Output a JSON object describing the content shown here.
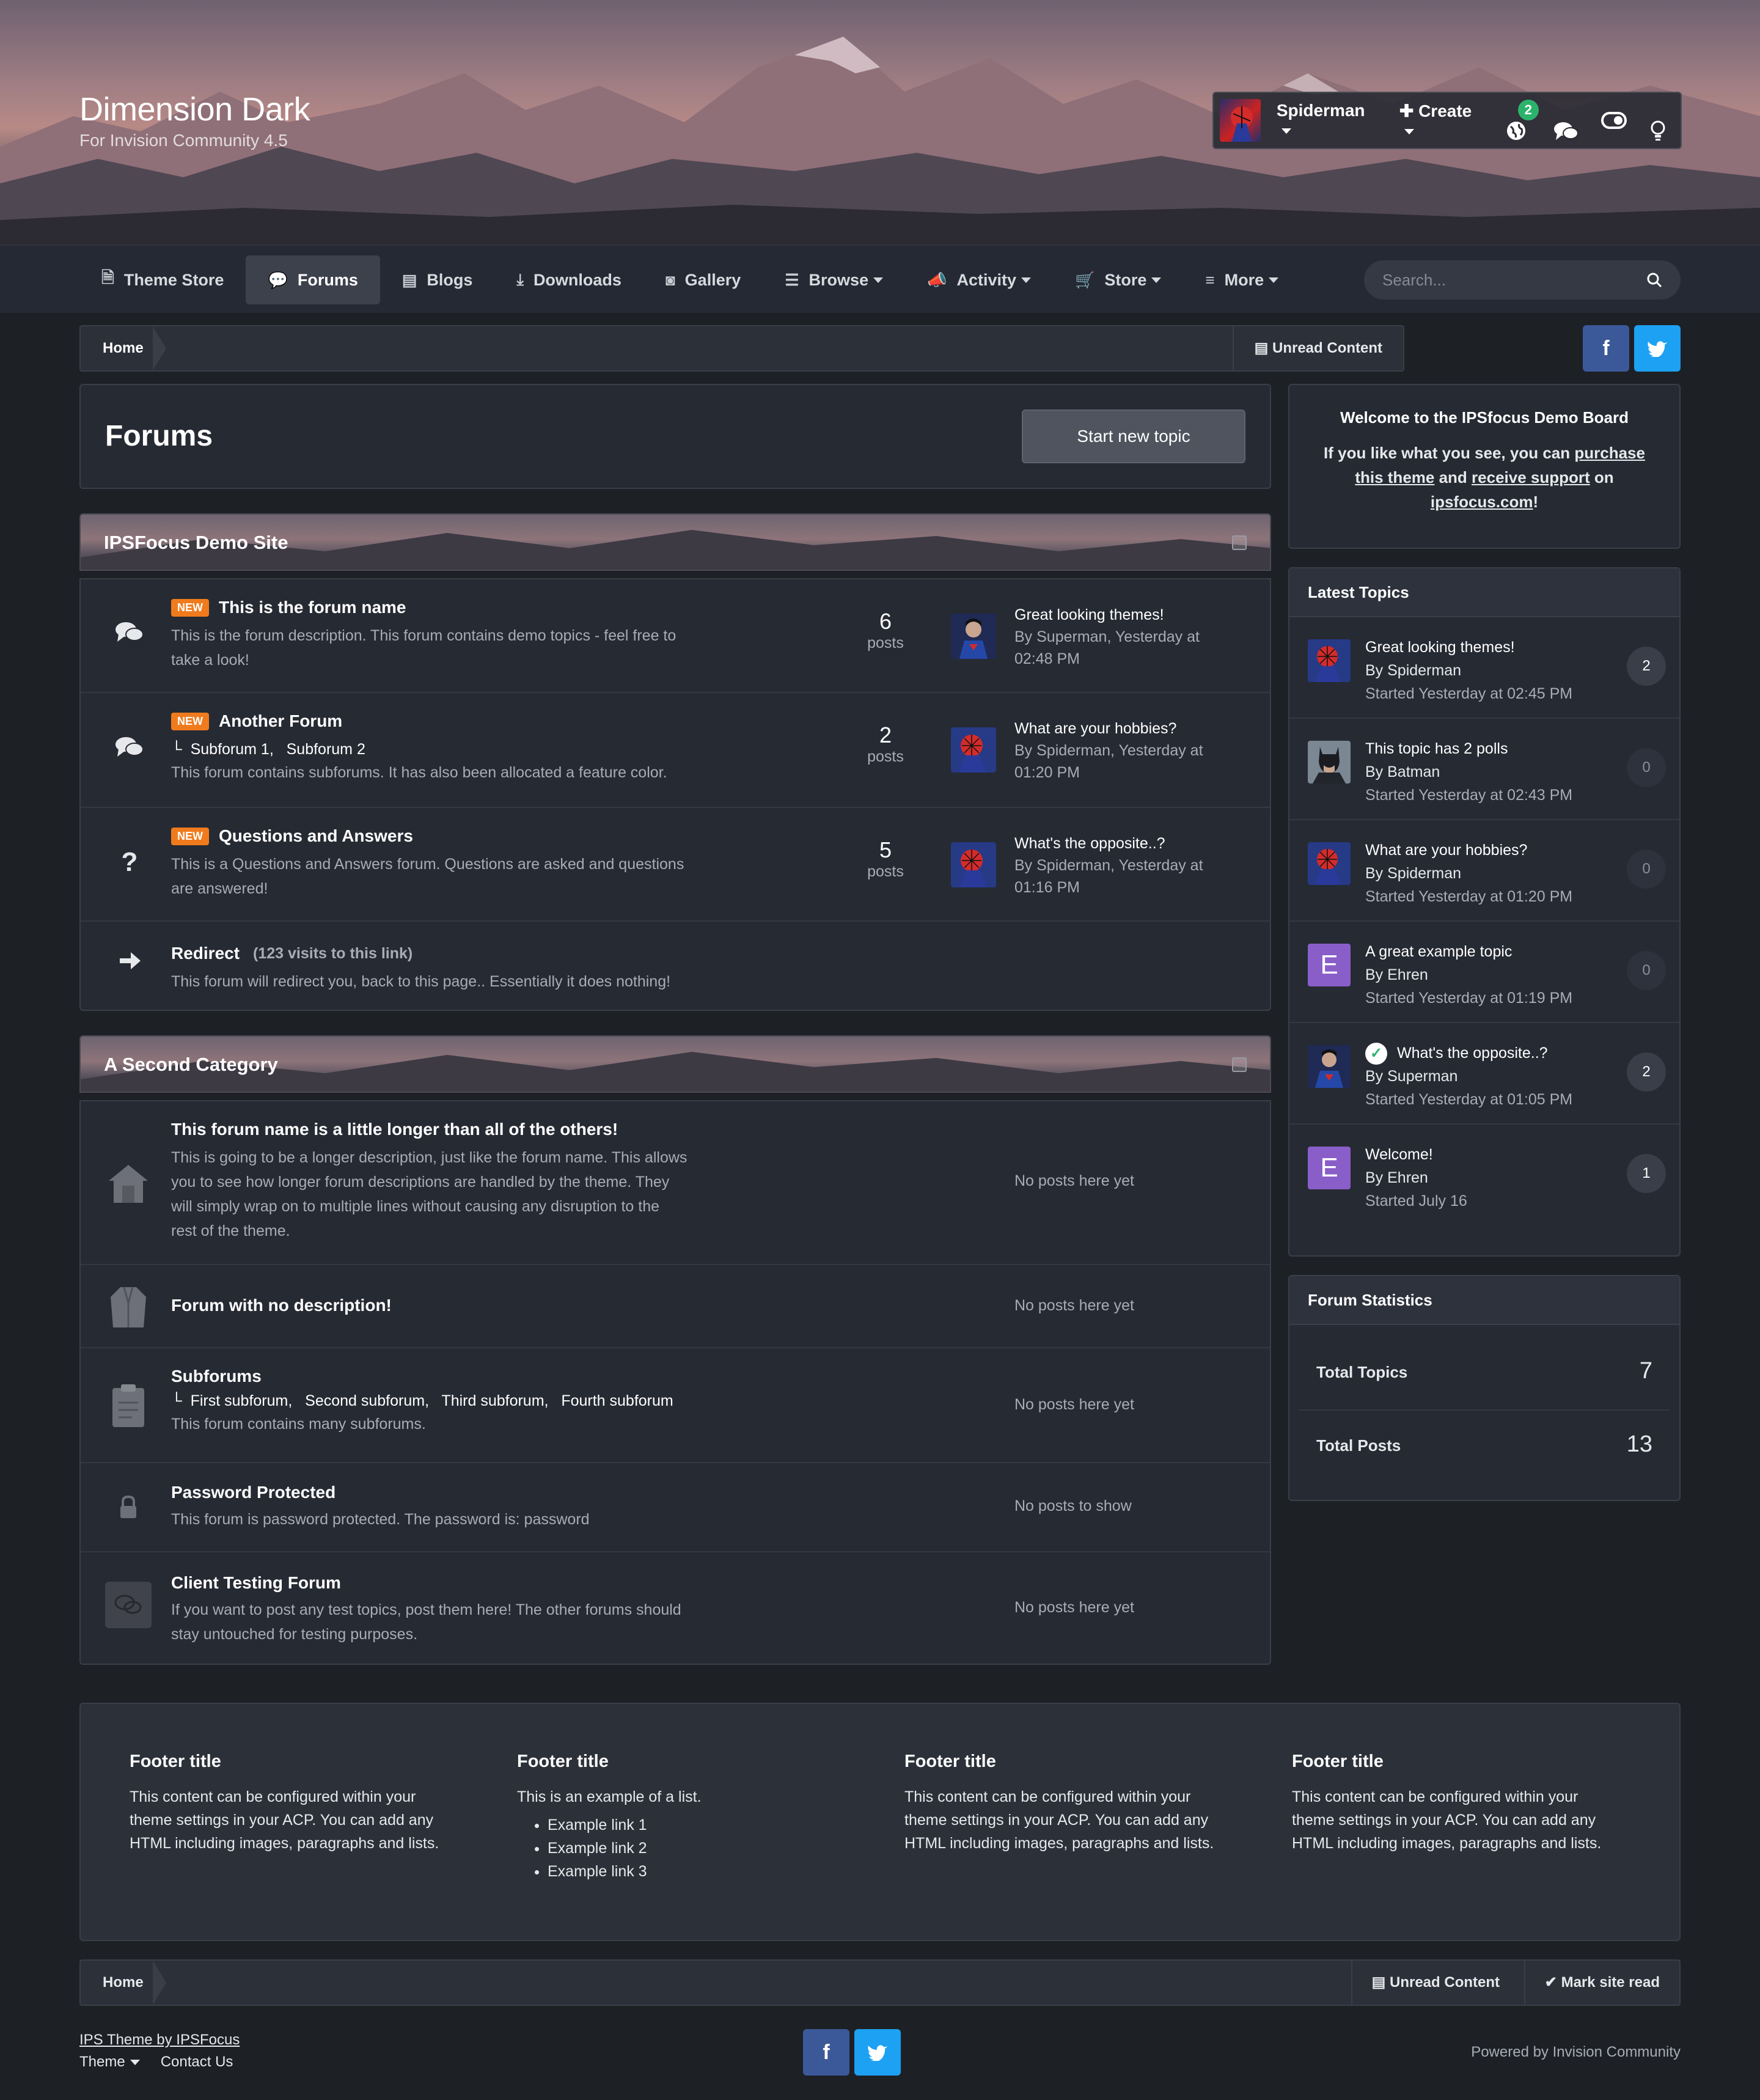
{
  "brand": {
    "title": "Dimension Dark",
    "subtitle": "For Invision Community 4.5"
  },
  "userbar": {
    "username": "Spiderman",
    "create_label": "Create",
    "notification_count": "2"
  },
  "nav": {
    "items": [
      {
        "label": "Theme Store",
        "icon": "document-icon"
      },
      {
        "label": "Forums",
        "icon": "chat-icon"
      },
      {
        "label": "Blogs",
        "icon": "book-icon"
      },
      {
        "label": "Downloads",
        "icon": "download-icon"
      },
      {
        "label": "Gallery",
        "icon": "camera-icon"
      },
      {
        "label": "Browse",
        "icon": "list-icon"
      },
      {
        "label": "Activity",
        "icon": "megaphone-icon"
      },
      {
        "label": "Store",
        "icon": "cart-icon"
      },
      {
        "label": "More",
        "icon": "menu-icon"
      }
    ],
    "active": "Forums",
    "search_placeholder": "Search..."
  },
  "breadcrumb": {
    "home": "Home",
    "unread": "Unread Content",
    "mark_read": "Mark site read"
  },
  "page": {
    "title": "Forums",
    "new_topic": "Start new topic"
  },
  "categories": [
    {
      "name": "IPSFocus Demo Site",
      "forums": [
        {
          "name": "This is the forum name",
          "new": "NEW",
          "desc1": "This is the forum description. This forum contains demo topics - feel free to",
          "desc2": "take a look!",
          "count": "6",
          "count_label": "posts",
          "last_title": "Great looking themes!",
          "last_by": "By Superman, Yesterday at",
          "last_time": "02:48 PM"
        },
        {
          "name": "Another Forum",
          "new": "NEW",
          "subforums": "└  Subforum 1,   Subforum 2",
          "desc1": "This forum contains subforums. It has also been allocated a feature color.",
          "count": "2",
          "count_label": "posts",
          "last_title": "What are your hobbies?",
          "last_by": "By Spiderman, Yesterday at",
          "last_time": "01:20 PM"
        },
        {
          "name": "Questions and Answers",
          "new": "NEW",
          "desc1": "This is a Questions and Answers forum. Questions are asked and questions",
          "desc2": "are answered!",
          "count": "5",
          "count_label": "posts",
          "last_title": "What's the opposite..?",
          "last_by": "By Spiderman, Yesterday at",
          "last_time": "01:16 PM"
        },
        {
          "name": "Redirect",
          "visits": "(123 visits to this link)",
          "desc1": "This forum will redirect you, back to this page.. Essentially it does nothing!"
        }
      ]
    },
    {
      "name": "A Second Category",
      "forums": [
        {
          "name": "This forum name is a little longer than all of the others!",
          "desc1": "This is going to be a longer description, just like the forum name. This allows",
          "desc2": "you to see how longer forum descriptions are handled by the theme. They",
          "desc3": "will simply wrap on to multiple lines without causing any disruption to the",
          "desc4": "rest of the theme.",
          "last": "No posts here yet"
        },
        {
          "name": "Forum with no description!",
          "last": "No posts here yet"
        },
        {
          "name": "Subforums",
          "subforums": "└  First subforum,   Second subforum,   Third subforum,   Fourth subforum",
          "desc1": "This forum contains many subforums.",
          "last": "No posts here yet"
        },
        {
          "name": "Password Protected",
          "desc1": "This forum is password protected. The password is: password",
          "last": "No posts to show"
        },
        {
          "name": "Client Testing Forum",
          "desc1": "If you want to post any test topics, post them here! The other forums should",
          "desc2": "stay untouched for testing purposes.",
          "last": "No posts here yet"
        }
      ]
    }
  ],
  "welcome": {
    "title": "Welcome to the IPSfocus Demo Board",
    "line1a": "If you like what you see, you can ",
    "link1a": "purchase",
    "link1b": "this theme",
    "line2a": " and ",
    "link2": "receive support",
    "line2b": " on",
    "link3": "ipsfocus.com",
    "end": "!"
  },
  "latest": {
    "title": "Latest Topics",
    "topics": [
      {
        "title": "Great looking themes!",
        "by": "By Spiderman",
        "date": "Started Yesterday at 02:45 PM",
        "count": "2"
      },
      {
        "title": "This topic has 2 polls",
        "by": "By Batman",
        "date": "Started Yesterday at 02:43 PM",
        "count": "0"
      },
      {
        "title": "What are your hobbies?",
        "by": "By Spiderman",
        "date": "Started Yesterday at 01:20 PM",
        "count": "0"
      },
      {
        "title": "A great example topic",
        "by": "By Ehren",
        "date": "Started Yesterday at 01:19 PM",
        "count": "0",
        "letter": "E"
      },
      {
        "title": "What's the opposite..?",
        "by": "By Superman",
        "date": "Started Yesterday at 01:05 PM",
        "count": "2"
      },
      {
        "title": "Welcome!",
        "by": "By Ehren",
        "date": "Started July 16",
        "count": "1",
        "letter": "E"
      }
    ]
  },
  "stats": {
    "title": "Forum Statistics",
    "topics_label": "Total Topics",
    "topics": "7",
    "posts_label": "Total Posts",
    "posts": "13"
  },
  "footer": {
    "cols": [
      {
        "title": "Footer title",
        "l1": "This content can be configured within your",
        "l2": "theme settings in your ACP. You can add any",
        "l3": "HTML including images, paragraphs and lists."
      },
      {
        "title": "Footer title",
        "l1": "This is an example of a list.",
        "items": [
          "Example link 1",
          "Example link 2",
          "Example link 3"
        ]
      },
      {
        "title": "Footer title",
        "l1": "This content can be configured within your",
        "l2": "theme settings in your ACP. You can add any",
        "l3": "HTML including images, paragraphs and lists."
      },
      {
        "title": "Footer title",
        "l1": "This content can be configured within your",
        "l2": "theme settings in your ACP. You can add any",
        "l3": "HTML including images, paragraphs and lists."
      }
    ]
  },
  "bottom": {
    "credit": "IPS Theme by IPSFocus",
    "theme": "Theme",
    "contact": "Contact Us",
    "powered": "Powered by Invision Community"
  },
  "social": {
    "facebook": "f",
    "twitter": "t"
  },
  "colors": {
    "bg": "#1d2025",
    "panel": "#262a33",
    "new_badge": "#f07b1d",
    "notif_badge": "#2bb36b",
    "ehren_avatar": "#8a5ec9"
  }
}
